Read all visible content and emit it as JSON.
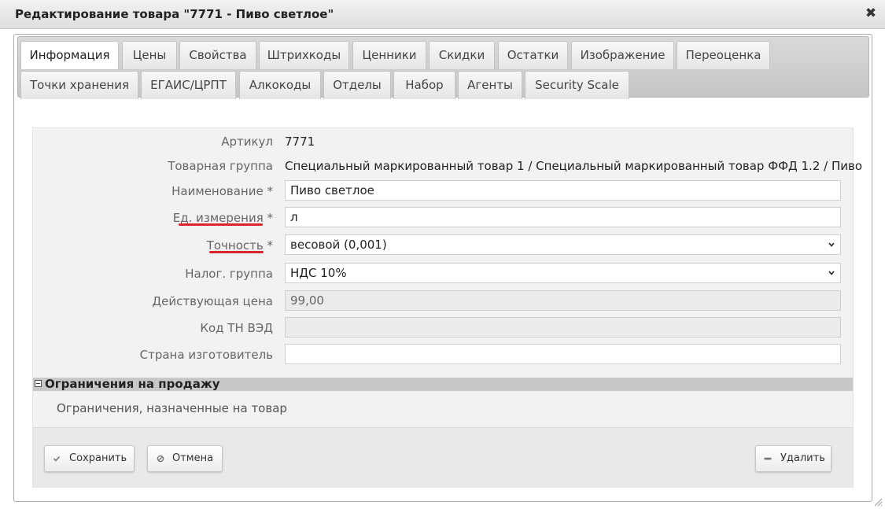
{
  "window": {
    "title": "Редактирование товара \"7771 - Пиво светлое\"",
    "close_glyph": "✖"
  },
  "tabs": {
    "row1": [
      "Информация",
      "Цены",
      "Свойства",
      "Штрихкоды",
      "Ценники",
      "Скидки",
      "Остатки",
      "Изображение",
      "Переоценка"
    ],
    "row2": [
      "Точки хранения",
      "ЕГАИС/ЦРПТ",
      "Алкокоды",
      "Отделы",
      "Набор",
      "Агенты",
      "Security Scale"
    ],
    "active": "Информация"
  },
  "form": {
    "article_label": "Артикул",
    "article_value": "7771",
    "group_label": "Товарная группа",
    "group_value": "Специальный маркированный товар 1 / Специальный маркированный товар ФФД 1.2 / Пиво",
    "name_label": "Наименование *",
    "name_value": "Пиво светлое",
    "unit_label": "Ед. измерения",
    "unit_required": "*",
    "unit_value": "л",
    "precision_label": "Точность",
    "precision_required": "*",
    "precision_value": "весовой (0,001)",
    "tax_label": "Налог. группа",
    "tax_value": "НДС 10%",
    "price_label": "Действующая цена",
    "price_value": "99,00",
    "tnved_label": "Код ТН ВЭД",
    "tnved_value": "",
    "country_label": "Страна изготовитель",
    "country_value": ""
  },
  "restrictions": {
    "title": "Ограничения на продажу",
    "text": "Ограничения, назначенные на товар"
  },
  "buttons": {
    "save": "Сохранить",
    "cancel": "Отмена",
    "delete": "Удалить"
  },
  "colors": {
    "annotation_underline": "#d9262c"
  },
  "icons": {
    "close": "close-icon",
    "save": "check-icon",
    "cancel": "cancel-icon",
    "delete": "minus-icon",
    "select": "chevron-down-icon",
    "collapse": "collapse-minus-icon",
    "resize": "resize-grip-icon"
  }
}
